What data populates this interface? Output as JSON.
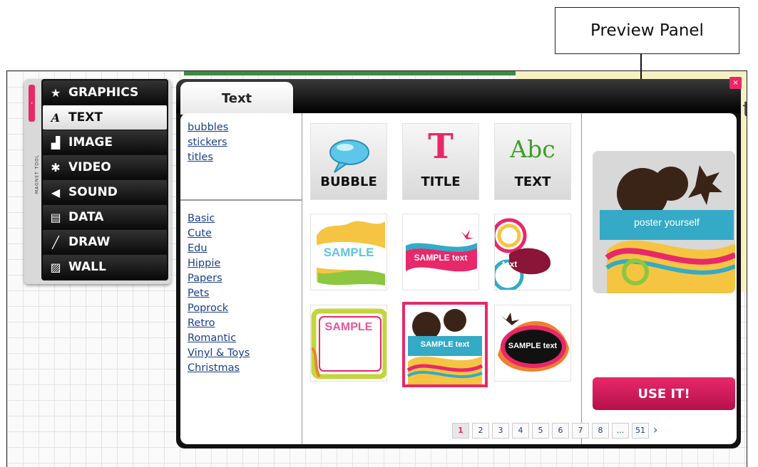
{
  "callout": {
    "label": "Preview Panel"
  },
  "magnet_tool": {
    "label": "MAGNET TOOL",
    "items": [
      {
        "label": "GRAPHICS",
        "icon": "star-icon",
        "glyph": "★",
        "active": false
      },
      {
        "label": "TEXT",
        "icon": "text-icon",
        "glyph": "A",
        "active": true
      },
      {
        "label": "IMAGE",
        "icon": "image-icon",
        "glyph": "▟",
        "active": false
      },
      {
        "label": "VIDEO",
        "icon": "video-icon",
        "glyph": "✱",
        "active": false
      },
      {
        "label": "SOUND",
        "icon": "sound-icon",
        "glyph": "◀",
        "active": false
      },
      {
        "label": "DATA",
        "icon": "data-icon",
        "glyph": "▤",
        "active": false
      },
      {
        "label": "DRAW",
        "icon": "pencil-icon",
        "glyph": "╱",
        "active": false
      },
      {
        "label": "WALL",
        "icon": "wall-icon",
        "glyph": "▨",
        "active": false
      }
    ]
  },
  "dialog": {
    "tab": "Text",
    "close_icon": "×",
    "categories_top": [
      "bubbles",
      "stickers",
      "titles"
    ],
    "categories": [
      "Basic",
      "Cute",
      "Edu",
      "Hippie",
      "Papers",
      "Pets",
      "Poprock",
      "Retro",
      "Romantic",
      "Vinyl & Toys",
      "Christmas"
    ],
    "tiles": [
      {
        "label": "BUBBLE"
      },
      {
        "label": "TITLE",
        "glyph": "T"
      },
      {
        "label": "TEXT",
        "glyph": "Abc"
      }
    ],
    "samples": [
      {
        "text": "SAMPLE"
      },
      {
        "text": "SAMPLE text"
      },
      {
        "text": "text"
      },
      {
        "text": "SAMPLE"
      },
      {
        "text": "SAMPLE text",
        "selected": true
      },
      {
        "text": "SAMPLE text"
      }
    ],
    "pagination": {
      "pages": [
        "1",
        "2",
        "3",
        "4",
        "5",
        "6",
        "7",
        "8",
        "...",
        "51"
      ],
      "current": "1",
      "next": "›"
    },
    "preview": {
      "banner_text": "poster yourself"
    },
    "use_button": "USE IT!"
  },
  "colors": {
    "accent": "#e8286a",
    "teal": "#34aac6",
    "link": "#1a3f8a"
  }
}
